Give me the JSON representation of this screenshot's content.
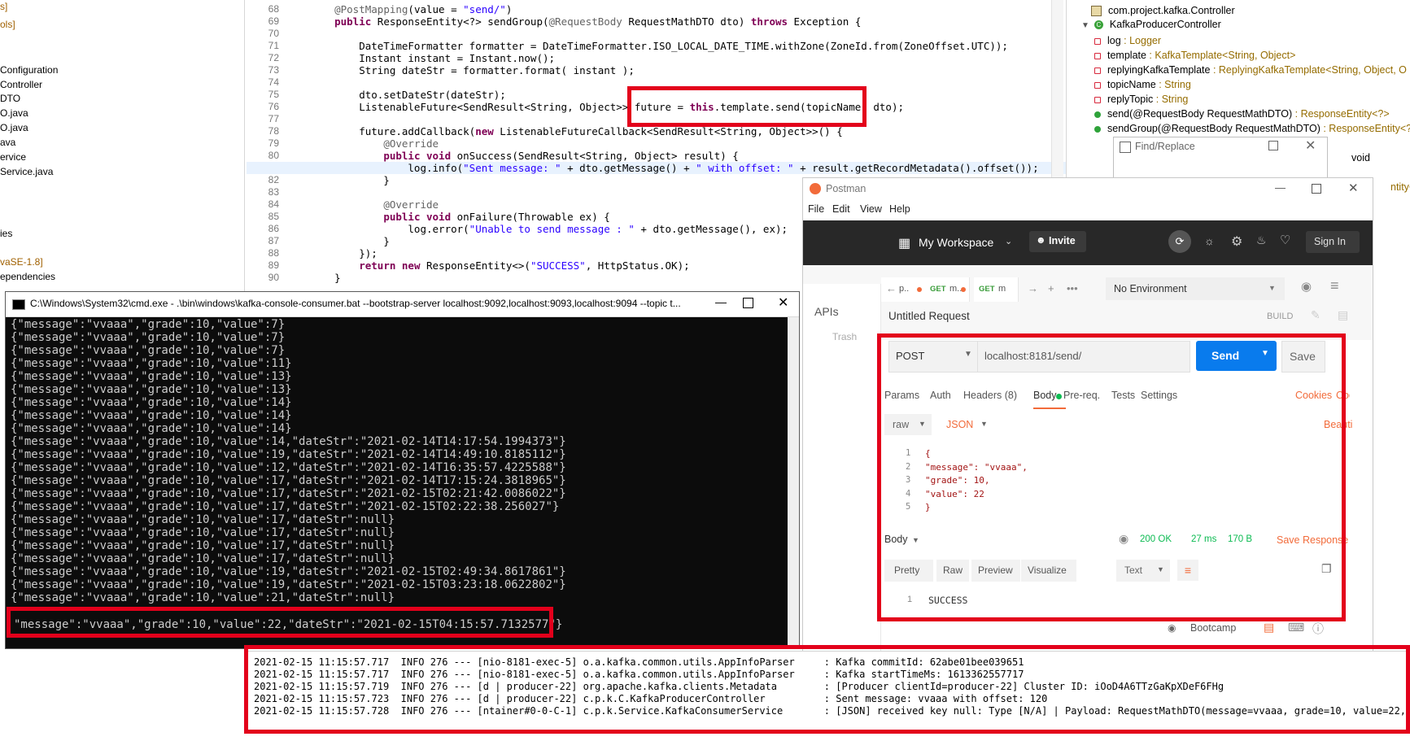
{
  "project_explorer": {
    "items": [
      {
        "label": "s]",
        "tone": "brown"
      },
      {
        "label": "ols]",
        "tone": "brown"
      },
      {
        "label": "Configuration",
        "tone": "plain"
      },
      {
        "label": "Controller",
        "tone": "plain"
      },
      {
        "label": "DTO",
        "tone": "plain"
      },
      {
        "label": "O.java",
        "tone": "plain"
      },
      {
        "label": "O.java",
        "tone": "plain"
      },
      {
        "label": "ava",
        "tone": "plain"
      },
      {
        "label": "ervice",
        "tone": "plain"
      },
      {
        "label": "Service.java",
        "tone": "plain"
      },
      {
        "label": "ies",
        "tone": "plain"
      },
      {
        "label": "vaSE-1.8]",
        "tone": "brown"
      },
      {
        "label": "ependencies",
        "tone": "plain"
      }
    ]
  },
  "editor": {
    "line_numbers": [
      "68",
      "69",
      "70",
      "71",
      "72",
      "73",
      "74",
      "75",
      "76",
      "77",
      "78",
      "79",
      "80",
      "81",
      "82",
      "83",
      "84",
      "85",
      "86",
      "87",
      "88",
      "89",
      "90"
    ],
    "lines": [
      "    @PostMapping(value = \"send/\")",
      "    public ResponseEntity<?> sendGroup(@RequestBody RequestMathDTO dto) throws Exception {",
      "",
      "        DateTimeFormatter formatter = DateTimeFormatter.ISO_LOCAL_DATE_TIME.withZone(ZoneId.from(ZoneOffset.UTC));",
      "        Instant instant = Instant.now();",
      "        String dateStr = formatter.format( instant );",
      "",
      "        dto.setDateStr(dateStr);",
      "        ListenableFuture<SendResult<String, Object>> future = this.template.send(topicName, dto);",
      "",
      "        future.addCallback(new ListenableFutureCallback<SendResult<String, Object>>() {",
      "            @Override",
      "            public void onSuccess(SendResult<String, Object> result) {",
      "                log.info(\"Sent message: \" + dto.getMessage() + \" with offset: \" + result.getRecordMetadata().offset());",
      "            }",
      "",
      "            @Override",
      "            public void onFailure(Throwable ex) {",
      "                log.error(\"Unable to send message : \" + dto.getMessage(), ex);",
      "            }",
      "        });",
      "        return new ResponseEntity<>(\"SUCCESS\", HttpStatus.OK);",
      "    }"
    ],
    "highlighted_code": "this.template.send(topicName, dto);"
  },
  "outline": {
    "package": "com.project.kafka.Controller",
    "class_name": "KafkaProducerController",
    "members": [
      {
        "name": "log",
        "type": " : Logger",
        "icon_color": "#d8283c",
        "icon": "field-private-icon"
      },
      {
        "name": "template",
        "type": " : KafkaTemplate<String, Object>",
        "icon_color": "#d8283c",
        "icon": "field-private-icon"
      },
      {
        "name": "replyingKafkaTemplate",
        "type": " : ReplyingKafkaTemplate<String, Object, O",
        "icon_color": "#d8283c",
        "icon": "field-private-icon"
      },
      {
        "name": "topicName",
        "type": " : String",
        "icon_color": "#d8283c",
        "icon": "field-private-icon"
      },
      {
        "name": "replyTopic",
        "type": " : String",
        "icon_color": "#d8283c",
        "icon": "field-private-icon"
      },
      {
        "name": "send(@RequestBody RequestMathDTO)",
        "type": " : ResponseEntity<?>",
        "icon_color": "#2fa33a",
        "icon": "method-public-icon"
      },
      {
        "name": "sendGroup(@RequestBody RequestMathDTO)",
        "type": " : ResponseEntity<?>",
        "icon_color": "#2fa33a",
        "icon": "method-public-icon"
      }
    ],
    "overflow_void": "void",
    "overflow_tity": "ntity<?>"
  },
  "find_replace": {
    "title": "Find/Replace"
  },
  "cmd": {
    "title": "C:\\Windows\\System32\\cmd.exe - .\\bin\\windows\\kafka-console-consumer.bat  --bootstrap-server localhost:9092,localhost:9093,localhost:9094 --topic t...",
    "lines": [
      "{\"message\":\"vvaaa\",\"grade\":10,\"value\":7}",
      "{\"message\":\"vvaaa\",\"grade\":10,\"value\":7}",
      "{\"message\":\"vvaaa\",\"grade\":10,\"value\":7}",
      "{\"message\":\"vvaaa\",\"grade\":10,\"value\":11}",
      "{\"message\":\"vvaaa\",\"grade\":10,\"value\":13}",
      "{\"message\":\"vvaaa\",\"grade\":10,\"value\":13}",
      "{\"message\":\"vvaaa\",\"grade\":10,\"value\":14}",
      "{\"message\":\"vvaaa\",\"grade\":10,\"value\":14}",
      "{\"message\":\"vvaaa\",\"grade\":10,\"value\":14}",
      "{\"message\":\"vvaaa\",\"grade\":10,\"value\":14,\"dateStr\":\"2021-02-14T14:17:54.1994373\"}",
      "{\"message\":\"vvaaa\",\"grade\":10,\"value\":19,\"dateStr\":\"2021-02-14T14:49:10.8185112\"}",
      "{\"message\":\"vvaaa\",\"grade\":10,\"value\":12,\"dateStr\":\"2021-02-14T16:35:57.4225588\"}",
      "{\"message\":\"vvaaa\",\"grade\":10,\"value\":17,\"dateStr\":\"2021-02-14T17:15:24.3818965\"}",
      "{\"message\":\"vvaaa\",\"grade\":10,\"value\":17,\"dateStr\":\"2021-02-15T02:21:42.0086022\"}",
      "{\"message\":\"vvaaa\",\"grade\":10,\"value\":17,\"dateStr\":\"2021-02-15T02:22:38.256027\"}",
      "{\"message\":\"vvaaa\",\"grade\":10,\"value\":17,\"dateStr\":null}",
      "{\"message\":\"vvaaa\",\"grade\":10,\"value\":17,\"dateStr\":null}",
      "{\"message\":\"vvaaa\",\"grade\":10,\"value\":17,\"dateStr\":null}",
      "{\"message\":\"vvaaa\",\"grade\":10,\"value\":17,\"dateStr\":null}",
      "{\"message\":\"vvaaa\",\"grade\":10,\"value\":19,\"dateStr\":\"2021-02-15T02:49:34.8617861\"}",
      "{\"message\":\"vvaaa\",\"grade\":10,\"value\":19,\"dateStr\":\"2021-02-15T03:23:18.0622802\"}",
      "{\"message\":\"vvaaa\",\"grade\":10,\"value\":21,\"dateStr\":null}"
    ],
    "last_line": "\"message\":\"vvaaa\",\"grade\":10,\"value\":22,\"dateStr\":\"2021-02-15T04:15:57.7132577\"}"
  },
  "postman": {
    "app_name": "Postman",
    "menu": [
      "File",
      "Edit",
      "View",
      "Help"
    ],
    "workspace": "My Workspace",
    "invite": "Invite",
    "sign_in": "Sign In",
    "tabs": [
      {
        "method": "",
        "label": "p..",
        "dot": "#f26b3a"
      },
      {
        "method": "GET",
        "label": "m..",
        "dot": "#f26b3a"
      },
      {
        "method": "GET",
        "label": "m",
        "dot": ""
      }
    ],
    "environment": "No Environment",
    "sidebar": [
      "APIs",
      "Trash"
    ],
    "request_name": "Untitled Request",
    "build": "BUILD",
    "method": "POST",
    "url": "localhost:8181/send/",
    "send": "Send",
    "save": "Save",
    "req_tabs": [
      "Params",
      "Auth",
      "Headers (8)",
      "Body",
      "Pre-req.",
      "Tests",
      "Settings"
    ],
    "cookies": "Cookies",
    "code": "Code",
    "body_type": "raw",
    "body_format": "JSON",
    "beautify": "Beauti",
    "body_line_numbers": [
      "1",
      "2",
      "3",
      "4",
      "5"
    ],
    "body_lines": [
      "{",
      "    \"message\": \"vvaaa\",",
      "    \"grade\": 10,",
      "    \"value\": 22",
      "}"
    ],
    "response_label": "Body",
    "status": "200 OK",
    "time": "27 ms",
    "size": "170 B",
    "save_response": "Save Response",
    "view_tabs": [
      "Pretty",
      "Raw",
      "Preview",
      "Visualize"
    ],
    "view_format": "Text",
    "response_line_number": "1",
    "response_body": "SUCCESS",
    "bootcamp": "Bootcamp",
    "colors": {
      "accent": "#f26b3a",
      "send": "#097bed",
      "status": "#0cbb52"
    }
  },
  "console": {
    "lines": [
      "2021-02-15 11:15:57.717  INFO 276 --- [nio-8181-exec-5] o.a.kafka.common.utils.AppInfoParser     : Kafka commitId: 62abe01bee039651",
      "2021-02-15 11:15:57.717  INFO 276 --- [nio-8181-exec-5] o.a.kafka.common.utils.AppInfoParser     : Kafka startTimeMs: 1613362557717",
      "2021-02-15 11:15:57.719  INFO 276 --- [d | producer-22] org.apache.kafka.clients.Metadata        : [Producer clientId=producer-22] Cluster ID: iOoD4A6TTzGaKpXDeF6FHg",
      "2021-02-15 11:15:57.723  INFO 276 --- [d | producer-22] c.p.k.C.KafkaProducerController          : Sent message: vvaaa with offset: 120",
      "2021-02-15 11:15:57.728  INFO 276 --- [ntainer#0-0-C-1] c.p.k.Service.KafkaConsumerService       : [JSON] received key null: Type [N/A] | Payload: RequestMathDTO(message=vvaaa, grade=10, value=22, dat"
    ]
  }
}
